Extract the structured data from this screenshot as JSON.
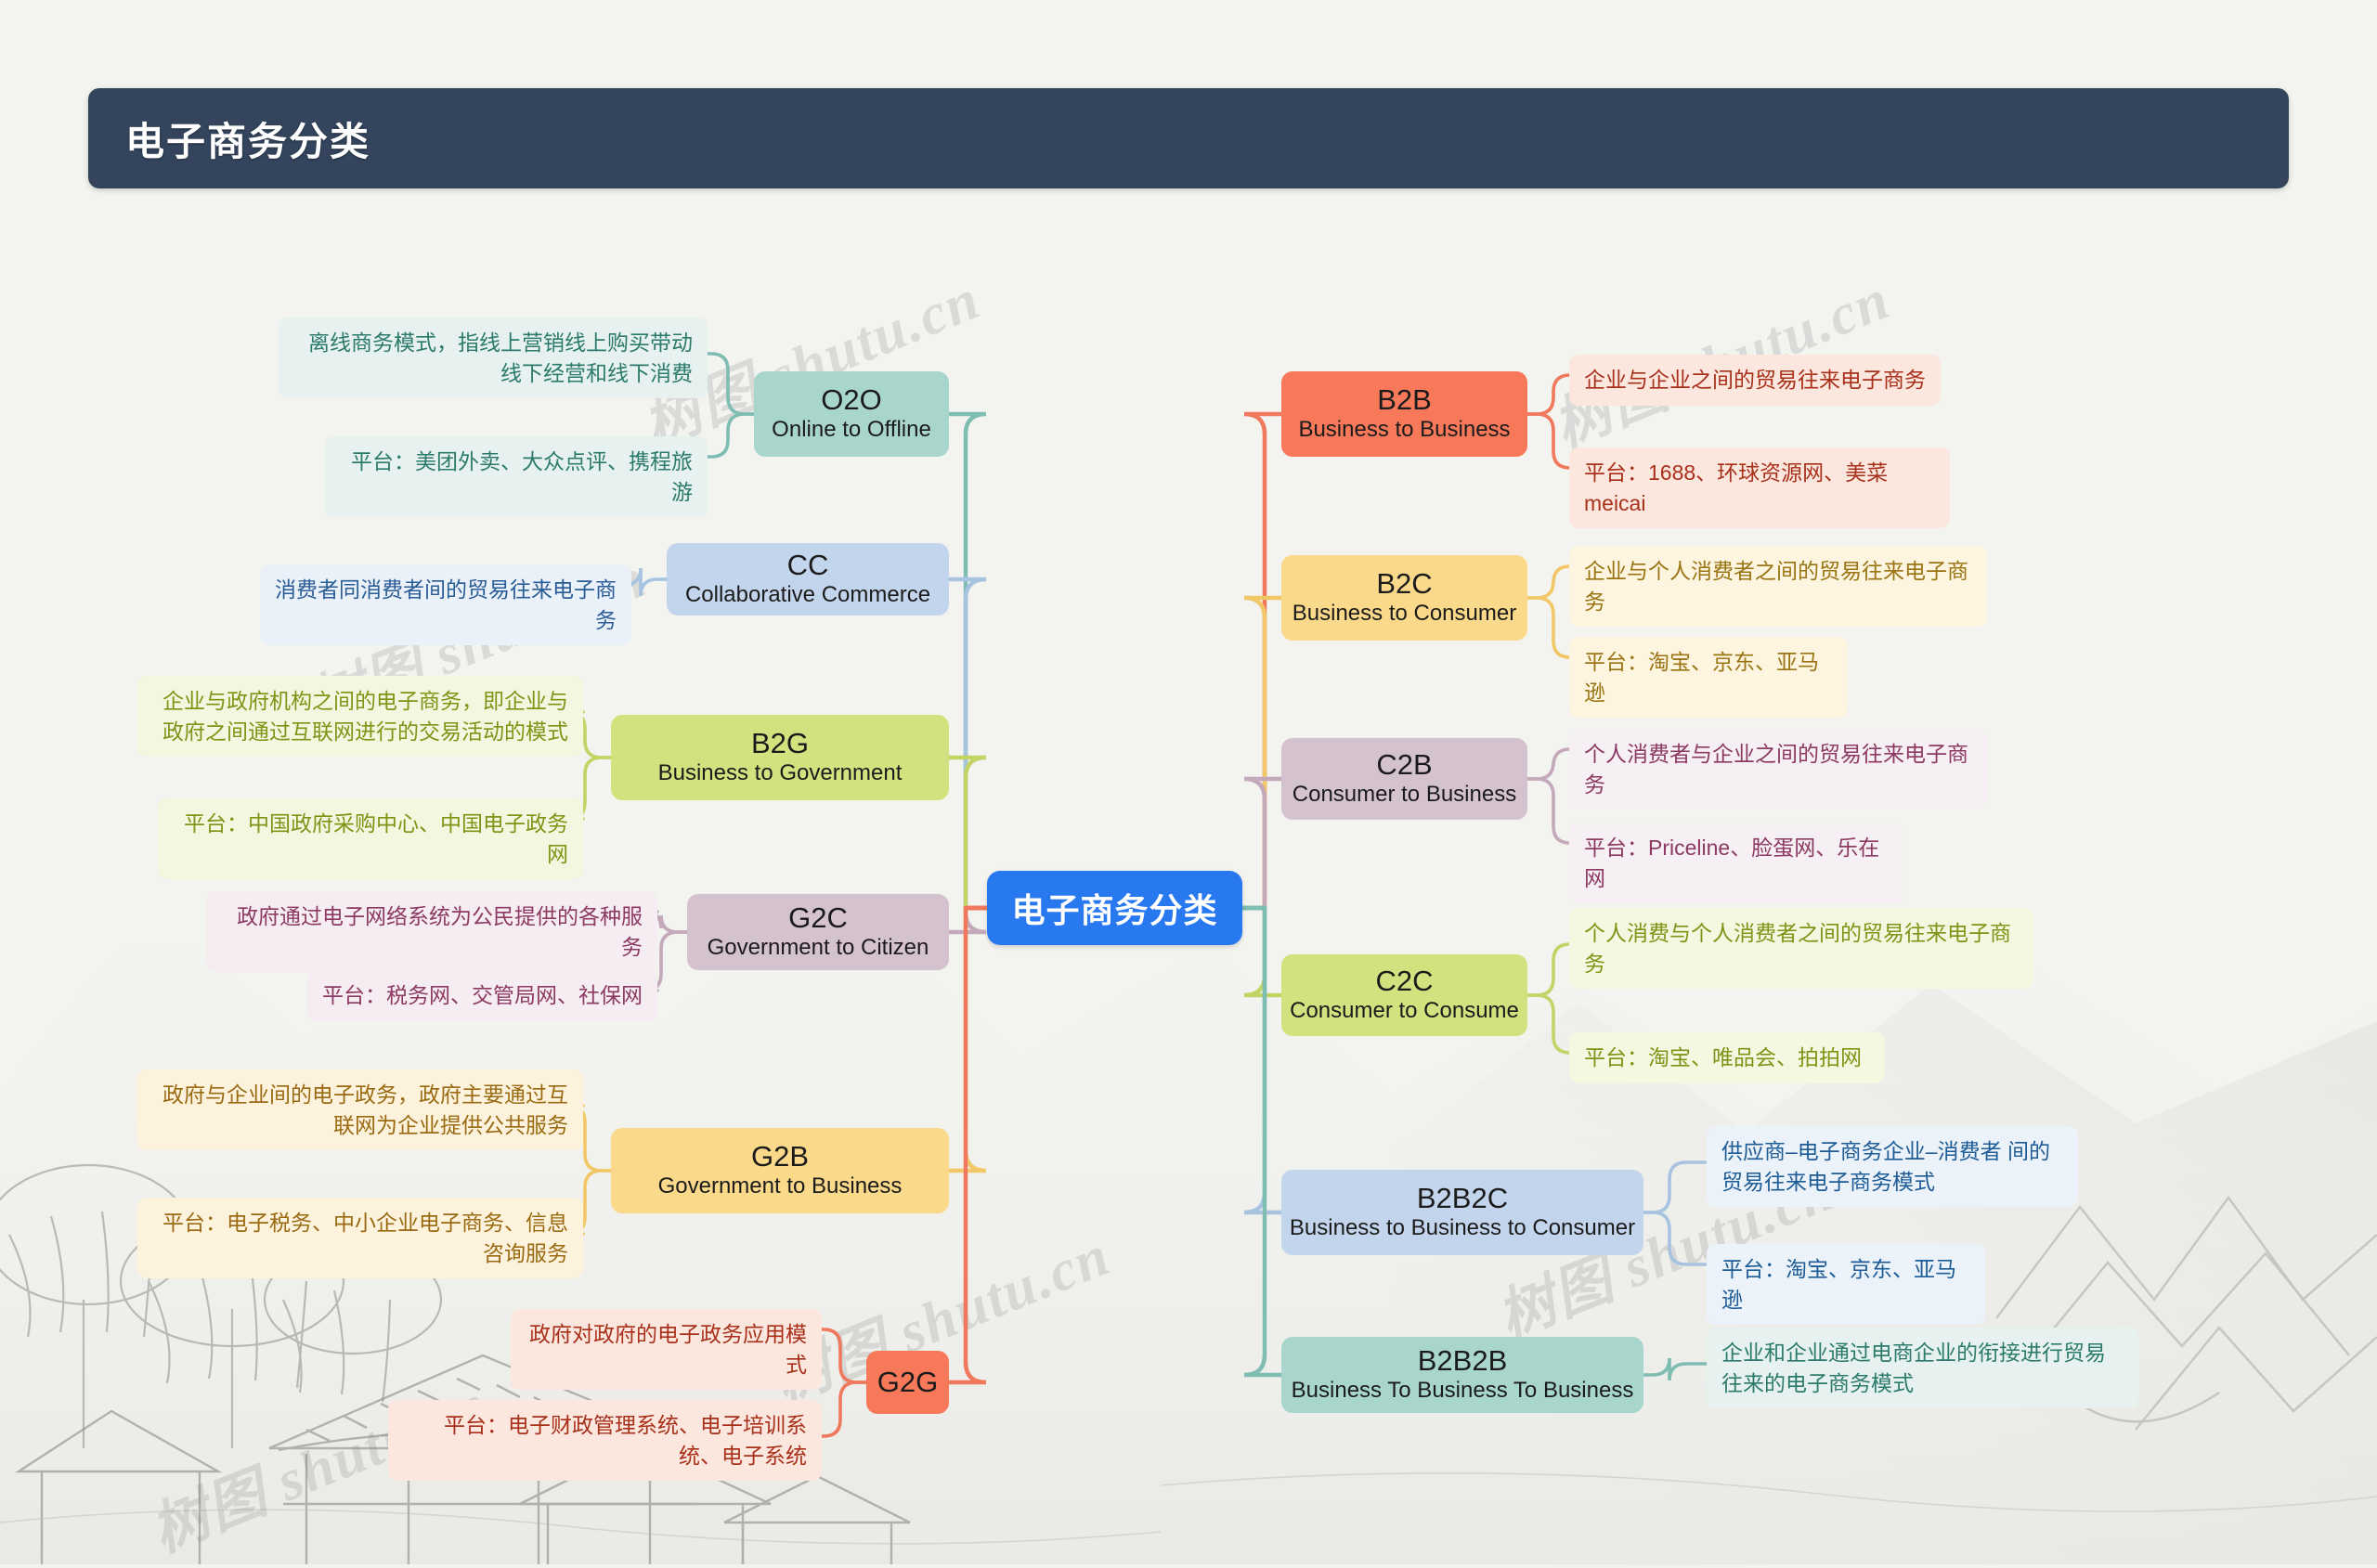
{
  "header": {
    "title": "电子商务分类"
  },
  "root": {
    "label": "电子商务分类",
    "color": "#2878f0"
  },
  "watermarks": [
    "树图 shutu.cn",
    "树图 shutu.cn",
    "树图 shutu.cn",
    "树图 shutu.cn",
    "树图 shutu.cn",
    "树图 shutu.cn"
  ],
  "left_branches": [
    {
      "code": "O2O",
      "full": "Online to Offline",
      "color": "#a8d5cc",
      "line_color": "#7fbdb2",
      "leaf_bg": "#e7f2f0",
      "leaf_text": "#2b7a6b",
      "leaves": [
        "离线商务模式，指线上营销线上购买带动线下经营和线下消费",
        "平台：美团外卖、大众点评、携程旅游"
      ]
    },
    {
      "code": "CC",
      "full": "Collaborative Commerce",
      "color": "#c3d5ec",
      "line_color": "#a8c3e0",
      "leaf_bg": "#eaf1f9",
      "leaf_text": "#2a5c96",
      "leaves": [
        "消费者同消费者间的贸易往来电子商务"
      ]
    },
    {
      "code": "B2G",
      "full": "Business to Government",
      "color": "#d3e17f",
      "line_color": "#c3d466",
      "leaf_bg": "#f2f7df",
      "leaf_text": "#7f9416",
      "leaves": [
        "企业与政府机构之间的电子商务，即企业与政府之间通过互联网进行的交易活动的模式",
        "平台：中国政府采购中心、中国电子政务网"
      ]
    },
    {
      "code": "G2C",
      "full": "Government to Citizen",
      "color": "#d5c2cf",
      "line_color": "#c3a9ba",
      "leaf_bg": "#f6edf2",
      "leaf_text": "#8c3a63",
      "leaves": [
        "政府通过电子网络系统为公民提供的各种服务",
        "平台：税务网、交管局网、社保网"
      ]
    },
    {
      "code": "G2B",
      "full": "Government to Business",
      "color": "#fad98a",
      "line_color": "#f2c767",
      "leaf_bg": "#fdf3dc",
      "leaf_text": "#9a6a12",
      "leaves": [
        "政府与企业间的电子政务，政府主要通过互联网为企业提供公共服务",
        "平台：电子税务、中小企业电子商务、信息咨询服务"
      ]
    },
    {
      "code": "G2G",
      "full": "",
      "color": "#f7795a",
      "line_color": "#f0785c",
      "leaf_bg": "#fce7df",
      "leaf_text": "#a8301a",
      "leaves": [
        "政府对政府的电子政务应用模式",
        "平台：电子财政管理系统、电子培训系统、电子系统"
      ]
    }
  ],
  "right_branches": [
    {
      "code": "B2B",
      "full": "Business to Business",
      "color": "#f7795a",
      "line_color": "#f0785c",
      "leaf_bg": "#fce7df",
      "leaf_text": "#a8301a",
      "leaves": [
        "企业与企业之间的贸易往来电子商务",
        "平台：1688、环球资源网、美菜meicai"
      ]
    },
    {
      "code": "B2C",
      "full": "Business to Consumer",
      "color": "#fad98a",
      "line_color": "#f2c767",
      "leaf_bg": "#fdf5e0",
      "leaf_text": "#9a7412",
      "leaves": [
        "企业与个人消费者之间的贸易往来电子商务",
        "平台：淘宝、京东、亚马逊"
      ]
    },
    {
      "code": "C2B",
      "full": "Consumer to Business",
      "color": "#d5c2cf",
      "line_color": "#c3a9ba",
      "leaf_bg": "#f6eff3",
      "leaf_text": "#8c3a63",
      "leaves": [
        "个人消费者与企业之间的贸易往来电子商务",
        "平台：Priceline、脸蛋网、乐在网"
      ]
    },
    {
      "code": "C2C",
      "full": "Consumer to Consume",
      "color": "#d3e17f",
      "line_color": "#c3d466",
      "leaf_bg": "#f4f8e1",
      "leaf_text": "#7f9416",
      "leaves": [
        "个人消费与个人消费者之间的贸易往来电子商务",
        "平台：淘宝、唯品会、拍拍网"
      ]
    },
    {
      "code": "B2B2C",
      "full": "Business to Business to Consumer",
      "color": "#c3d5ec",
      "line_color": "#a8c3e0",
      "leaf_bg": "#ecf2f9",
      "leaf_text": "#1d5c96",
      "leaves": [
        "供应商–电子商务企业–消费者 间的贸易往来电子商务模式",
        "平台：淘宝、京东、亚马逊"
      ]
    },
    {
      "code": "B2B2B",
      "full": "Business To Business To Business",
      "color": "#a8d5cc",
      "line_color": "#7fbdb2",
      "leaf_bg": "#e7f2f0",
      "leaf_text": "#2b7a6b",
      "leaves": [
        "企业和企业通过电商企业的衔接进行贸易往来的电子商务模式"
      ]
    }
  ]
}
